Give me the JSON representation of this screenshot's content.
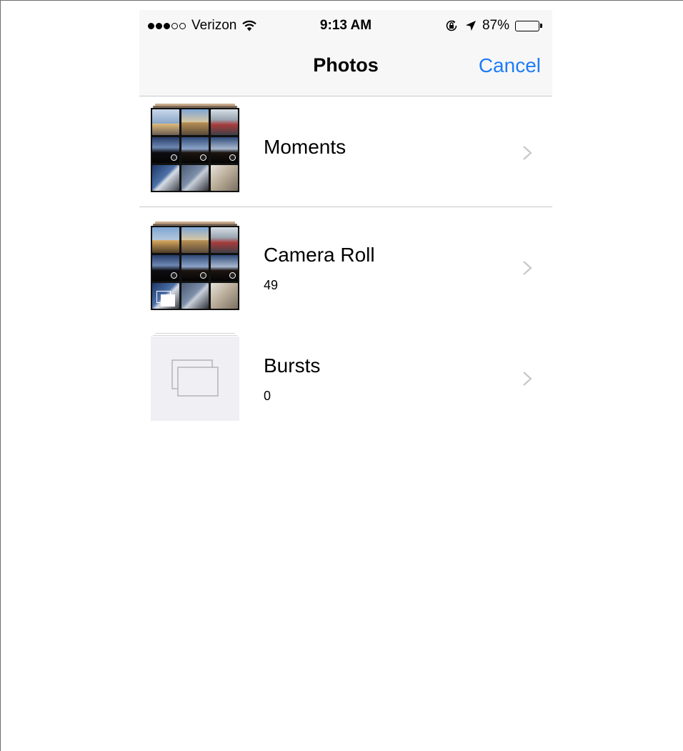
{
  "status_bar": {
    "signal_strength": "3 of 5 dots",
    "carrier": "Verizon",
    "time": "9:13 AM",
    "battery_percent": "87%",
    "battery_level": 0.87
  },
  "nav": {
    "title": "Photos",
    "cancel_label": "Cancel"
  },
  "albums": [
    {
      "name": "Moments",
      "count": ""
    },
    {
      "name": "Camera Roll",
      "count": "49"
    },
    {
      "name": "Bursts",
      "count": "0"
    }
  ],
  "colors": {
    "accent": "#1e7cf5",
    "separator": "#c8c7cc",
    "chevron": "#c7c7cc",
    "nav_background": "#f7f7f8"
  },
  "icons": {
    "signal": "signal-dots-icon",
    "wifi": "wifi-icon",
    "orientation_lock": "orientation-lock-icon",
    "location": "location-arrow-icon",
    "battery": "battery-icon",
    "chevron": "chevron-right-icon",
    "placeholder": "empty-album-icon"
  }
}
